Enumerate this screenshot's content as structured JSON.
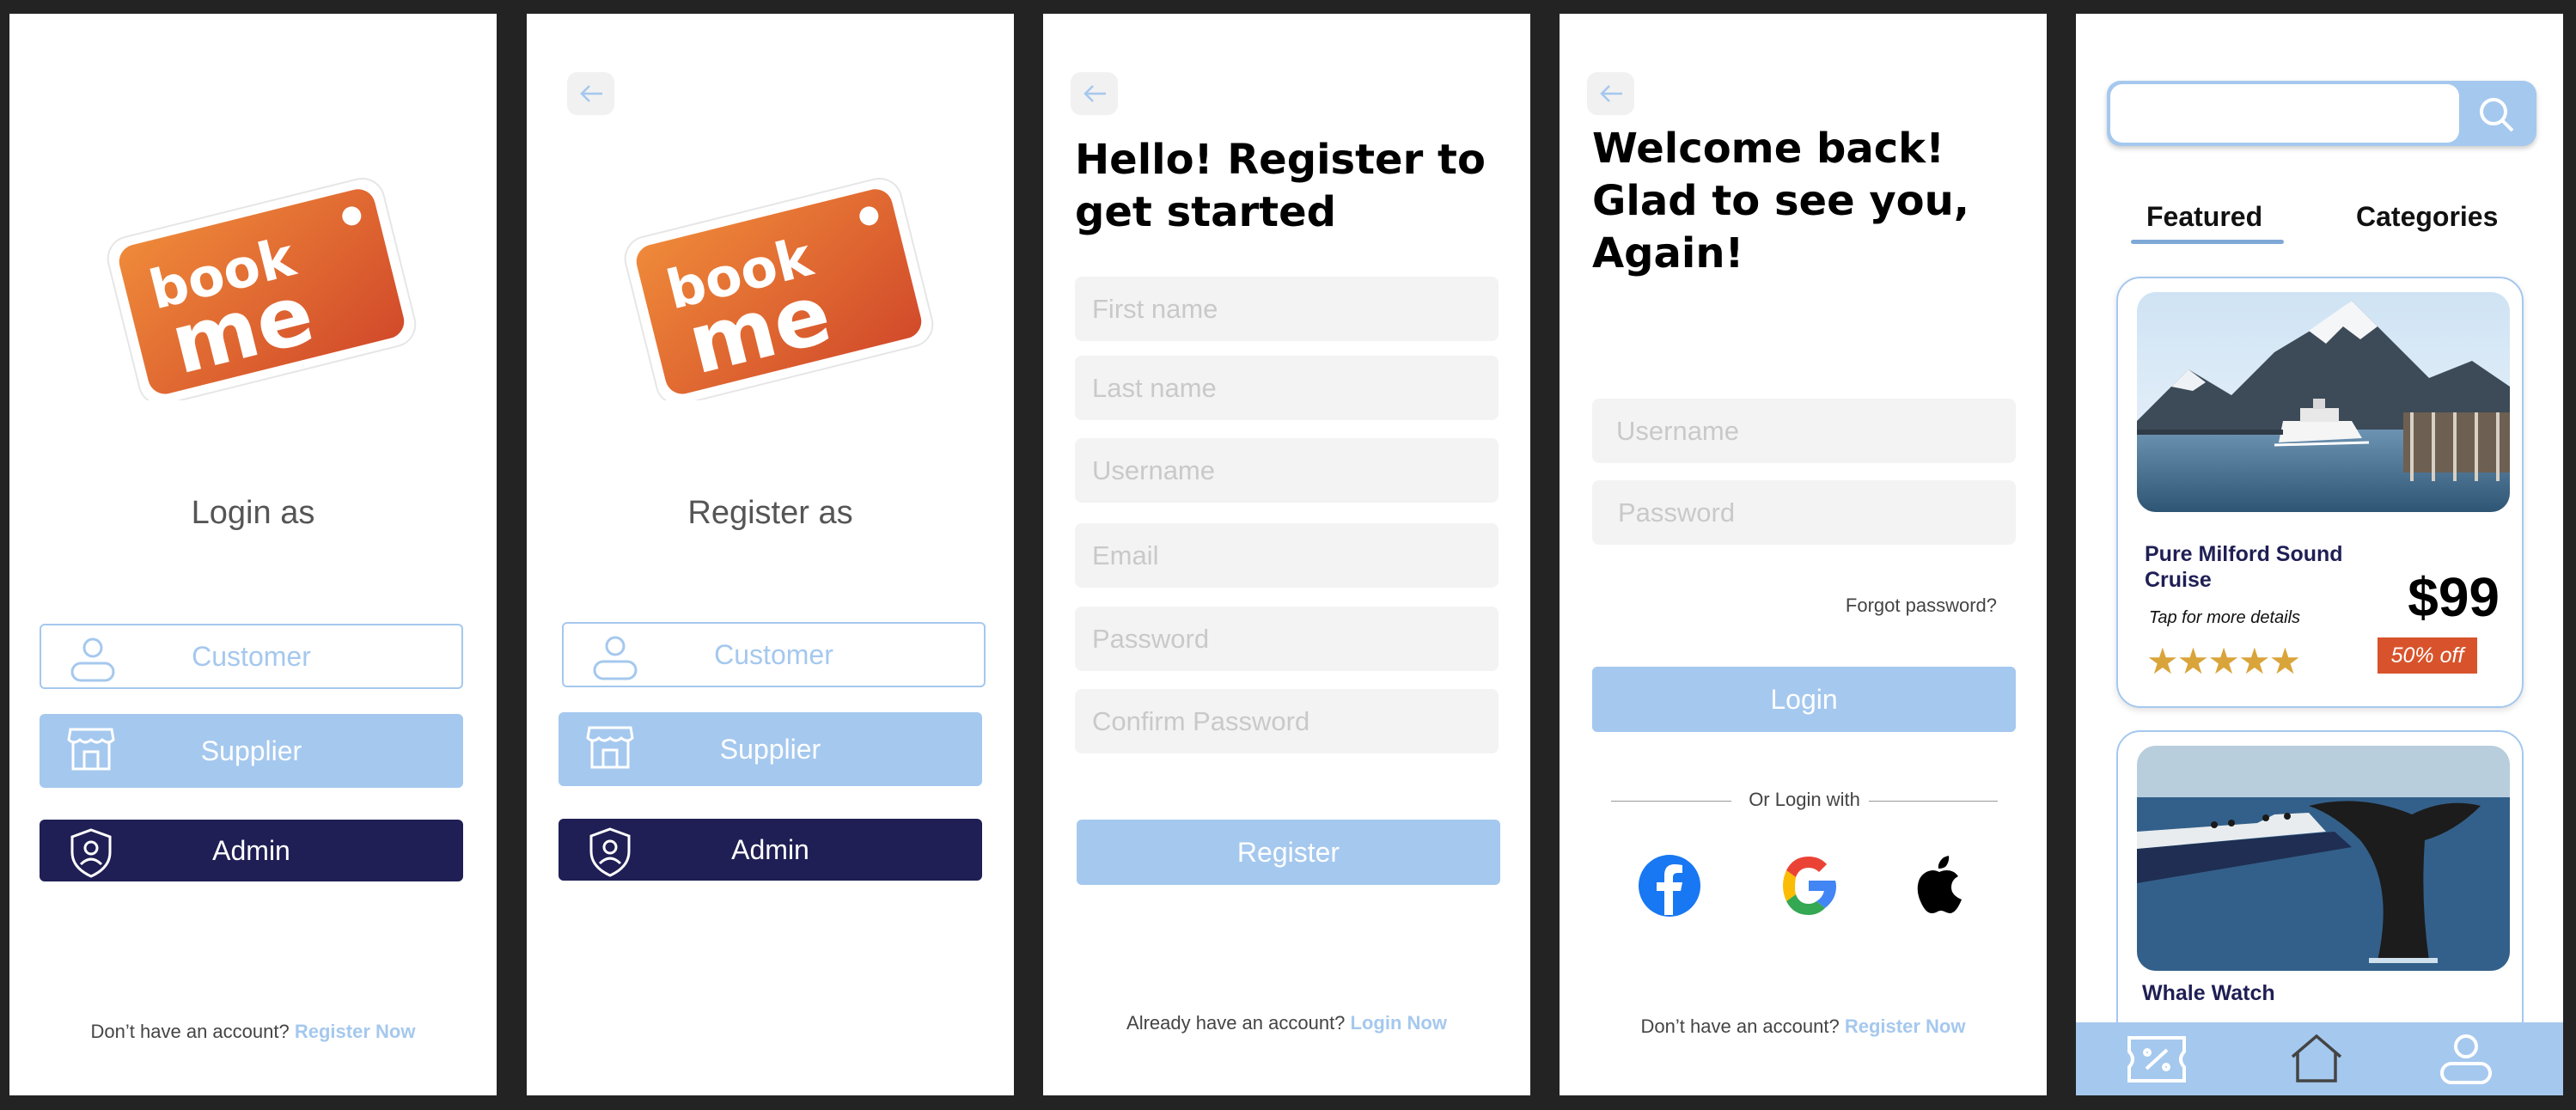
{
  "login_as": {
    "title": "Login as",
    "roles": {
      "customer": "Customer",
      "supplier": "Supplier",
      "admin": "Admin"
    },
    "footer_text": "Don’t have an account?",
    "footer_link": "Register Now"
  },
  "register_as": {
    "title": "Register as",
    "roles": {
      "customer": "Customer",
      "supplier": "Supplier",
      "admin": "Admin"
    }
  },
  "register": {
    "heading_line1": "Hello! Register to",
    "heading_line2": "get started",
    "fields": {
      "first_name": "First name",
      "last_name": "Last name",
      "username": "Username",
      "email": "Email",
      "password": "Password",
      "confirm_password": "Confirm Password"
    },
    "button": "Register",
    "footer_text": "Already have an account?",
    "footer_link": "Login Now"
  },
  "login": {
    "heading_line1": "Welcome back!",
    "heading_line2": "Glad to see you,",
    "heading_line3": "Again!",
    "fields": {
      "username": "Username",
      "password": "Password"
    },
    "forgot": "Forgot password?",
    "button": "Login",
    "divider": "Or Login with",
    "social_icons": [
      "facebook-icon",
      "google-icon",
      "apple-icon"
    ],
    "footer_text": "Don’t have an account?",
    "footer_link": "Register Now"
  },
  "browse": {
    "tabs": {
      "featured": "Featured",
      "categories": "Categories"
    },
    "cards": [
      {
        "title": "Pure Milford Sound Cruise",
        "hint": "Tap for more details",
        "price": "$99",
        "badge": "50% off",
        "stars": 5
      },
      {
        "title": "Whale Watch"
      }
    ],
    "nav_icons": [
      "discount-icon",
      "home-icon",
      "profile-icon"
    ]
  },
  "brand": {
    "logo_line1": "book",
    "logo_line2": "me"
  },
  "colors": {
    "accent": "#a5c8ee",
    "navy": "#1f1f55",
    "orange": "#e0602d",
    "background": "#232323",
    "star": "#d9a43a"
  }
}
